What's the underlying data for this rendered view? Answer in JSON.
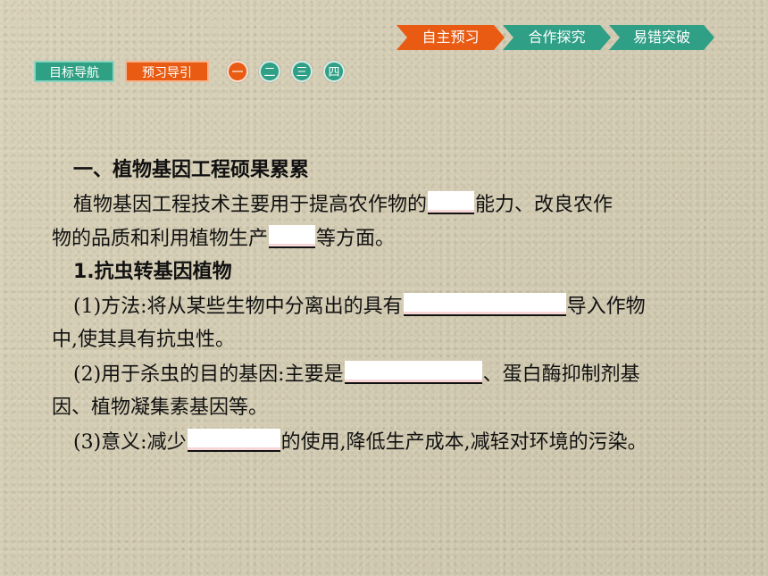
{
  "top_nav": {
    "items": [
      "自主预习",
      "合作探究",
      "易错突破"
    ]
  },
  "left_nav": {
    "target_nav": "目标导航",
    "preview_guide": "预习导引",
    "step_icons": [
      "一",
      "二",
      "三",
      "四"
    ]
  },
  "content": {
    "heading_1": "一、植物基因工程硕果累累",
    "paragraph_1": {
      "line_1_part_1": "植物基因工程技术主要用于提高农作物的",
      "line_1_part_2": "能力、改良农作",
      "line_2_part_1": "物的品质和利用植物生产",
      "line_2_part_2": "等方面。"
    },
    "section_1": "1.抗虫转基因植物",
    "item_1": {
      "part_1": "(1)方法:将从某些生物中分离出的具有",
      "part_2": "导入作物",
      "line_2": "中,使其具有抗虫性。"
    },
    "item_2": {
      "part_1": "(2)用于杀虫的目的基因:主要是",
      "part_2": "、蛋白酶抑制剂基",
      "line_2": "因、植物凝集素基因等。"
    },
    "item_3": {
      "part_1": "(3)意义:减少",
      "part_2": "的使用,降低生产成本,减轻对环境的污染。"
    }
  },
  "colors": {
    "accent_orange": "#e95b12",
    "accent_teal": "#2f9f86"
  }
}
